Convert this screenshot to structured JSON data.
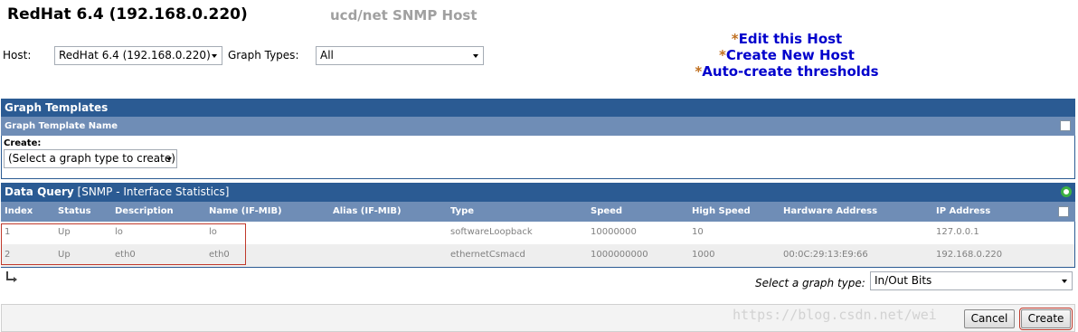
{
  "header": {
    "title": "RedHat 6.4 (192.168.0.220)",
    "host_type": "ucd/net SNMP Host"
  },
  "filters": {
    "host_label": "Host:",
    "host_value": "RedHat 6.4 (192.168.0.220)",
    "graph_types_label": "Graph Types:",
    "graph_types_value": "All"
  },
  "actions": [
    {
      "star": "*",
      "label": "Edit this Host"
    },
    {
      "star": "*",
      "label": "Create New Host"
    },
    {
      "star": "*",
      "label": "Auto-create thresholds"
    }
  ],
  "graph_templates": {
    "title": "Graph Templates",
    "column": "Graph Template Name",
    "create_label": "Create:",
    "create_value": "(Select a graph type to create)"
  },
  "data_query": {
    "title": "Data Query",
    "query_name": "[SNMP - Interface Statistics]",
    "columns": [
      "Index",
      "Status",
      "Description",
      "Name (IF-MIB)",
      "Alias (IF-MIB)",
      "Type",
      "Speed",
      "High Speed",
      "Hardware Address",
      "IP Address"
    ],
    "rows": [
      [
        "1",
        "Up",
        "lo",
        "lo",
        "",
        "softwareLoopback",
        "10000000",
        "10",
        "",
        "127.0.0.1"
      ],
      [
        "2",
        "Up",
        "eth0",
        "eth0",
        "",
        "ethernetCsmacd",
        "1000000000",
        "1000",
        "00:0C:29:13:E9:66",
        "192.168.0.220"
      ]
    ],
    "graph_type_label": "Select a graph type:",
    "graph_type_value": "In/Out Bits"
  },
  "buttons": {
    "cancel": "Cancel",
    "create": "Create"
  },
  "watermark": "https://blog.csdn.net/wei",
  "colors": {
    "header_bar": "#2b5b93",
    "subheader_bar": "#6f8db6",
    "link": "#0000cc",
    "star": "#c07020",
    "status_ok": "#3cb043"
  }
}
